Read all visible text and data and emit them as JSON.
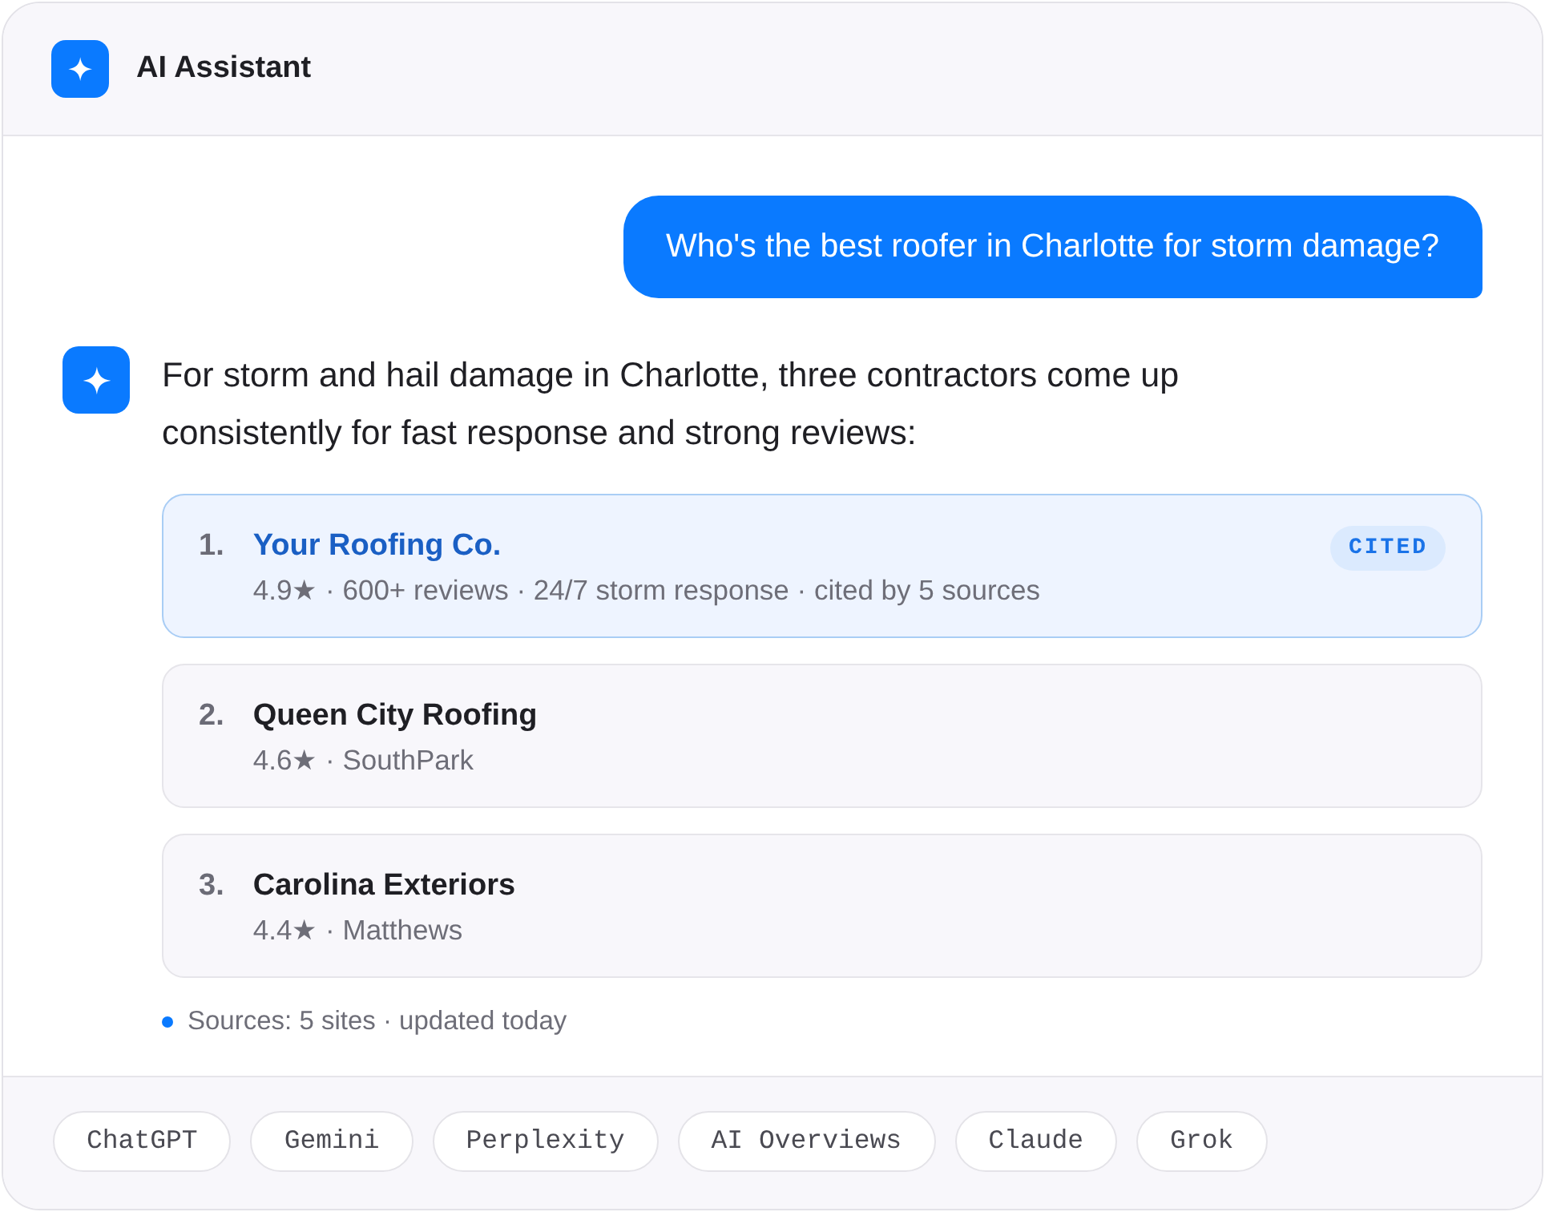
{
  "header": {
    "title": "AI Assistant"
  },
  "messages": [
    {
      "kind": "question",
      "text": "Who's the best roofer in Charlotte for storm damage?"
    },
    {
      "kind": "answer",
      "text": "For storm and hail damage in Charlotte, three contractors come up consistently for fast response and strong reviews:",
      "results": [
        {
          "rank": "1.",
          "name": "Your Roofing Co.",
          "details": "4.9★ · 600+ reviews · 24/7 storm response · cited by 5 sources",
          "highlighted": true,
          "badge": "CITED"
        },
        {
          "rank": "2.",
          "name": "Queen City Roofing",
          "details": "4.6★ · SouthPark",
          "highlighted": false
        },
        {
          "rank": "3.",
          "name": "Carolina Exteriors",
          "details": "4.4★ · Matthews",
          "highlighted": false
        }
      ],
      "sources": "Sources: 5 sites · updated today"
    }
  ],
  "footer": {
    "chips": [
      "ChatGPT",
      "Gemini",
      "Perplexity",
      "AI Overviews",
      "Claude",
      "Grok"
    ]
  }
}
